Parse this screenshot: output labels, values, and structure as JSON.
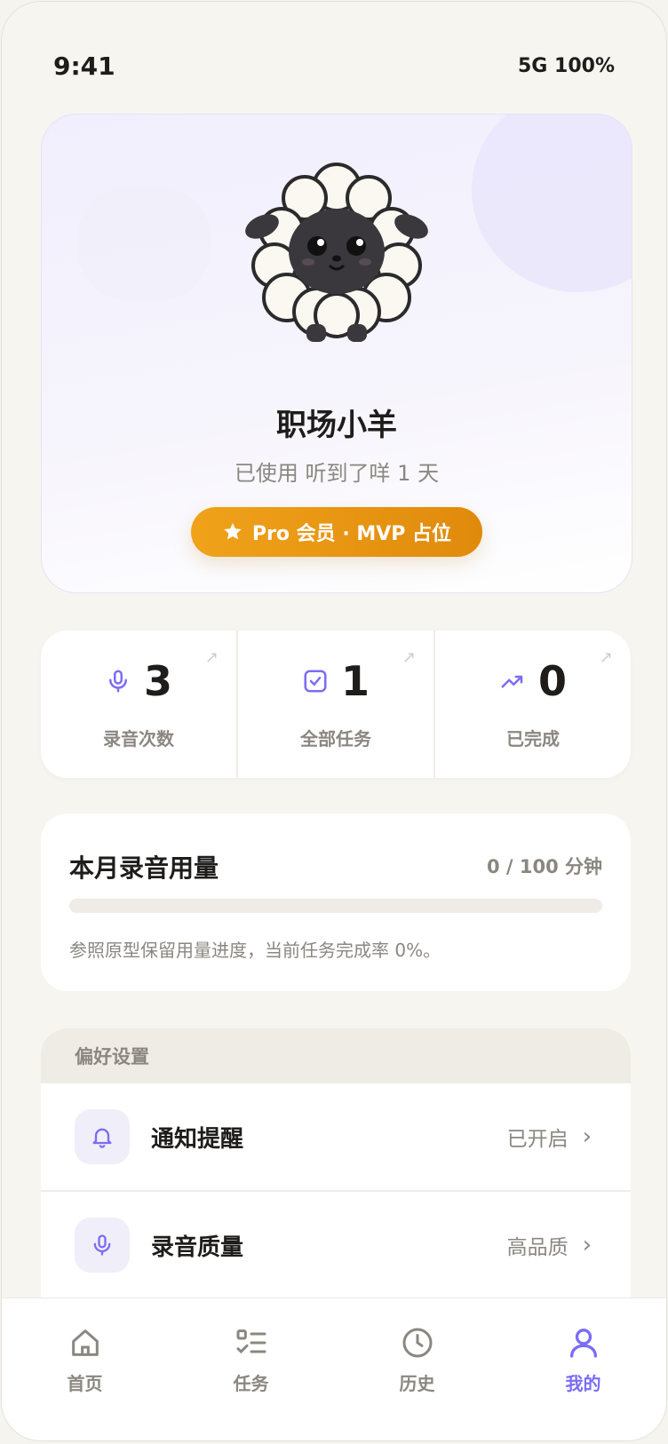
{
  "status_bar": {
    "time": "9:41",
    "network": "5G 100%"
  },
  "profile": {
    "name": "职场小羊",
    "since": "已使用 听到了咩 1 天",
    "badge": "Pro 会员 · MVP 占位"
  },
  "stats": [
    {
      "value": "3",
      "label": "录音次数",
      "icon": "mic-icon"
    },
    {
      "value": "1",
      "label": "全部任务",
      "icon": "checkbox-icon"
    },
    {
      "value": "0",
      "label": "已完成",
      "icon": "trend-up-icon"
    }
  ],
  "usage": {
    "title": "本月录音用量",
    "amount": "0 / 100 分钟",
    "progress": 0,
    "note": "参照原型保留用量进度，当前任务完成率 0%。"
  },
  "preferences": {
    "header": "偏好设置",
    "items": [
      {
        "label": "通知提醒",
        "value": "已开启",
        "icon": "bell-icon"
      },
      {
        "label": "录音质量",
        "value": "高品质",
        "icon": "mic-icon"
      }
    ]
  },
  "tabs": [
    {
      "label": "首页",
      "icon": "home-icon"
    },
    {
      "label": "任务",
      "icon": "tasks-icon"
    },
    {
      "label": "历史",
      "icon": "clock-icon"
    },
    {
      "label": "我的",
      "icon": "user-icon",
      "active": true
    }
  ],
  "colors": {
    "accent": "#7b6cf6",
    "badge": "#e8920f",
    "muted": "#8b8780"
  }
}
